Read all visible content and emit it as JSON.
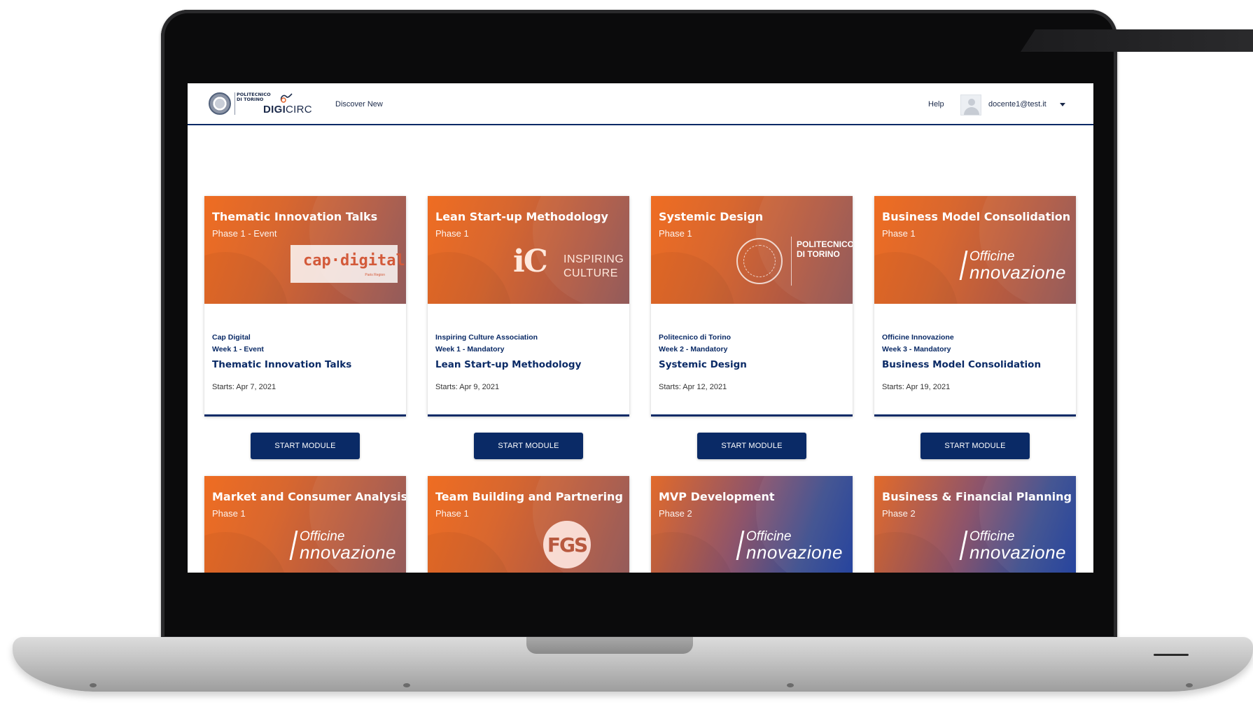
{
  "app": {
    "logo_university": "POLITECNICO DI TORINO",
    "logo_brand_bold": "DIGI",
    "logo_brand_light": "CIRC"
  },
  "nav": {
    "discover_label": "Discover New",
    "help_label": "Help",
    "user_email": "docente1@test.it"
  },
  "colors": {
    "primary_navy": "#0a2a66",
    "accent_orange": "#ef6d22",
    "accent_blue": "#193a9a"
  },
  "modules": [
    {
      "banner_title": "Thematic Innovation Talks",
      "banner_phase": "Phase 1 - Event",
      "logo": "cap-digital-logo",
      "logo_text": "cap·digital",
      "logo_subtext": "Paris Region",
      "provider": "Cap Digital",
      "week": "Week 1 - Event",
      "title": "Thematic Innovation Talks",
      "starts": "Starts: Apr 7, 2021",
      "button_label": "START MODULE"
    },
    {
      "banner_title": "Lean Start-up Methodology",
      "banner_phase": "Phase 1",
      "logo": "inspiring-culture-logo",
      "logo_mark": "iC",
      "logo_line1": "INSPIRING",
      "logo_line2": "CULTURE",
      "provider": "Inspiring Culture Association",
      "week": "Week 1 - Mandatory",
      "title": "Lean Start-up Methodology",
      "starts": "Starts: Apr 9, 2021",
      "button_label": "START MODULE"
    },
    {
      "banner_title": "Systemic Design",
      "banner_phase": "Phase 1",
      "logo": "politecnico-logo",
      "logo_line1": "POLITECNICO",
      "logo_line2": "DI TORINO",
      "provider": "Politecnico di Torino",
      "week": "Week 2 - Mandatory",
      "title": "Systemic Design",
      "starts": "Starts: Apr 12, 2021",
      "button_label": "START MODULE"
    },
    {
      "banner_title": "Business Model Consolidation",
      "banner_phase": "Phase 1",
      "logo": "officine-innovazione-logo",
      "logo_line1": "Officine",
      "logo_line2": "nnovazione",
      "provider": "Officine Innovazione",
      "week": "Week 3 - Mandatory",
      "title": "Business Model Consolidation",
      "starts": "Starts: Apr 19, 2021",
      "button_label": "START MODULE"
    },
    {
      "banner_title": "Market and Consumer Analysis",
      "banner_phase": "Phase 1",
      "logo_line1": "Officine",
      "logo_line2": "nnovazione"
    },
    {
      "banner_title": "Team Building and Partnering",
      "banner_phase": "Phase 1",
      "logo_text": "FGS"
    },
    {
      "banner_title": "MVP Development",
      "banner_phase": "Phase 2",
      "logo_line1": "Officine",
      "logo_line2": "nnovazione"
    },
    {
      "banner_title": "Business & Financial Planning",
      "banner_phase": "Phase 2",
      "logo_line1": "Officine",
      "logo_line2": "nnovazione"
    }
  ]
}
